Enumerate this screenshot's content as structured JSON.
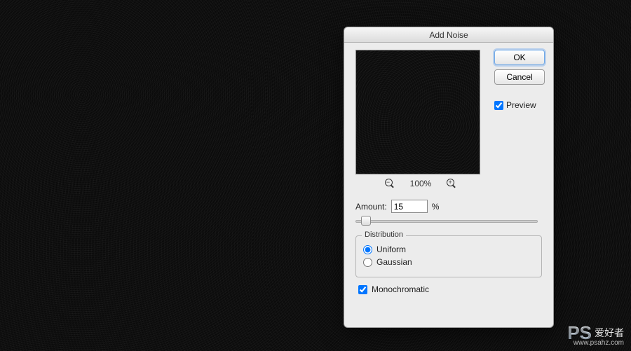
{
  "dialog": {
    "title": "Add Noise",
    "ok_label": "OK",
    "cancel_label": "Cancel",
    "preview_label": "Preview",
    "preview_checked": true,
    "zoom_level": "100%",
    "amount_label": "Amount:",
    "amount_value": "15",
    "amount_unit": "%",
    "distribution": {
      "legend": "Distribution",
      "options": [
        {
          "label": "Uniform",
          "checked": true
        },
        {
          "label": "Gaussian",
          "checked": false
        }
      ]
    },
    "monochromatic_label": "Monochromatic",
    "monochromatic_checked": true
  },
  "watermark": {
    "ps": "PS",
    "cn": "爱好者",
    "url": "www.psahz.com"
  }
}
